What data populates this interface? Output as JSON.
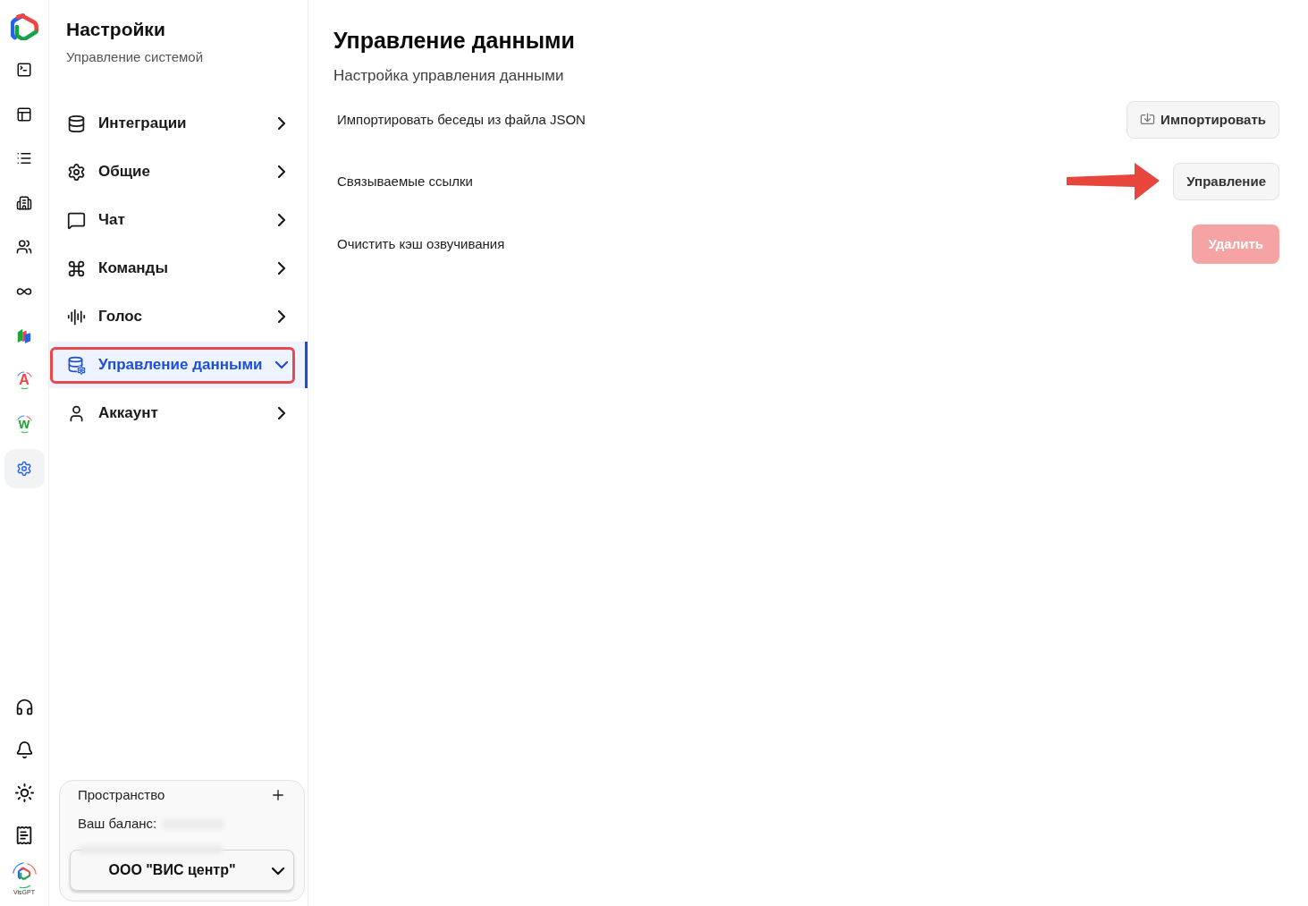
{
  "rail": {
    "items": [
      {
        "selected": false
      },
      {
        "selected": false
      },
      {
        "selected": false
      },
      {
        "selected": false
      },
      {
        "selected": false
      },
      {
        "selected": false
      },
      {
        "selected": false
      },
      {
        "selected": false,
        "letter": "A",
        "color": "#ef4444"
      },
      {
        "selected": false,
        "letter": "w",
        "color": "#22a33a"
      },
      {
        "selected": true
      }
    ],
    "logo_caption": "VisGPT"
  },
  "sidebar": {
    "title": "Настройки",
    "subtitle": "Управление системой",
    "items": [
      {
        "label": "Интеграции",
        "selected": false,
        "expanded": false,
        "highlighted": false
      },
      {
        "label": "Общие",
        "selected": false,
        "expanded": false,
        "highlighted": false
      },
      {
        "label": "Чат",
        "selected": false,
        "expanded": false,
        "highlighted": false
      },
      {
        "label": "Команды",
        "selected": false,
        "expanded": false,
        "highlighted": false
      },
      {
        "label": "Голос",
        "selected": false,
        "expanded": false,
        "highlighted": false
      },
      {
        "label": "Управление данными",
        "selected": true,
        "expanded": true,
        "highlighted": true
      },
      {
        "label": "Аккаунт",
        "selected": false,
        "expanded": false,
        "highlighted": false
      }
    ],
    "workspace": {
      "label": "Пространство",
      "balance_label": "Ваш баланс:",
      "organization": "ООО \"ВИС центр\""
    }
  },
  "main": {
    "title": "Управление данными",
    "subtitle": "Настройка управления данными",
    "rows": [
      {
        "label": "Импортировать беседы из файла JSON",
        "highlighted": false,
        "button": {
          "label": "Импортировать",
          "kind": "import",
          "disabled": false
        }
      },
      {
        "label": "Связываемые ссылки",
        "highlighted": true,
        "button": {
          "label": "Управление",
          "kind": "secondary",
          "disabled": false
        }
      },
      {
        "label": "Очистить кэш озвучивания",
        "highlighted": false,
        "button": {
          "label": "Удалить",
          "kind": "danger",
          "disabled": true
        }
      }
    ]
  }
}
